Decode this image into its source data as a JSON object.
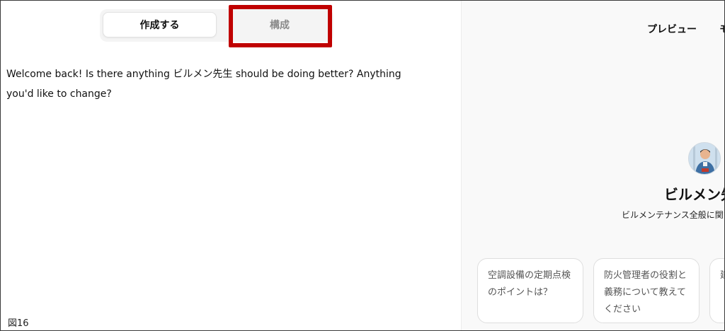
{
  "tabs": {
    "create_label": "作成する",
    "configure_label": "構成"
  },
  "editor": {
    "message": "Welcome back! Is there anything ビルメン先生 should be doing better? Anything you'd like to change?"
  },
  "figure_label": "図16",
  "preview": {
    "preview_tab": "プレビュー",
    "model_tab": "モ",
    "bot_name": "ビルメン先",
    "bot_description": "ビルメンテナンス全般に関する",
    "avatar_icon": "worker-avatar-icon",
    "starters": [
      {
        "text": "空調設備の定期点検のポイントは？"
      },
      {
        "text": "防火管理者の役割と義務について教えてください"
      },
      {
        "text": "建の"
      }
    ]
  },
  "colors": {
    "highlight": "#c00000",
    "muted_tab": "#8a8a8a"
  }
}
